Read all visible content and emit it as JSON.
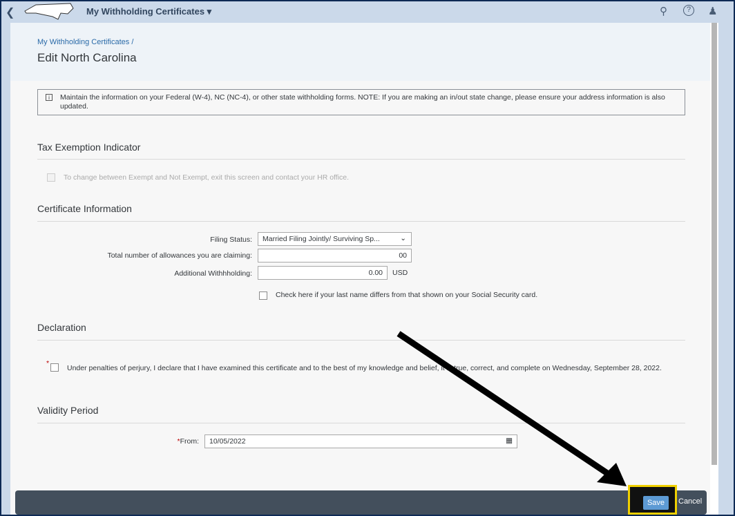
{
  "shell": {
    "title": "My Withholding Certificates"
  },
  "page": {
    "breadcrumb": "My Withholding Certificates /",
    "title": "Edit North Carolina"
  },
  "info": "Maintain the information on your Federal (W-4), NC (NC-4), or other state withholding forms. NOTE: If you are making an in/out state change, please ensure your address information is also updated.",
  "tax": {
    "heading": "Tax Exemption Indicator",
    "checkbox_label": "To change between Exempt and Not Exempt, exit this screen and contact your HR office."
  },
  "cert": {
    "heading": "Certificate Information",
    "filing_label": "Filing Status:",
    "filing_value": "Married Filing Jointly/ Surviving Sp...",
    "allow_label": "Total number of allowances you are claiming:",
    "allow_value": "00",
    "addl_label": "Additional Withhholding:",
    "addl_value": "0.00",
    "currency": "USD",
    "lastname_label": "Check here if your last name differs from that shown on your Social Security card."
  },
  "decl": {
    "heading": "Declaration",
    "required": "*",
    "text": "Under penalties of perjury, I declare that I have examined this certificate and to the best of my knowledge and belief, it is true, correct, and complete on Wednesday, September 28, 2022."
  },
  "validity": {
    "heading": "Validity Period",
    "from_label": "From:",
    "required": "*",
    "from_value": "10/05/2022"
  },
  "footer": {
    "save": "Save",
    "cancel": "Cancel"
  }
}
